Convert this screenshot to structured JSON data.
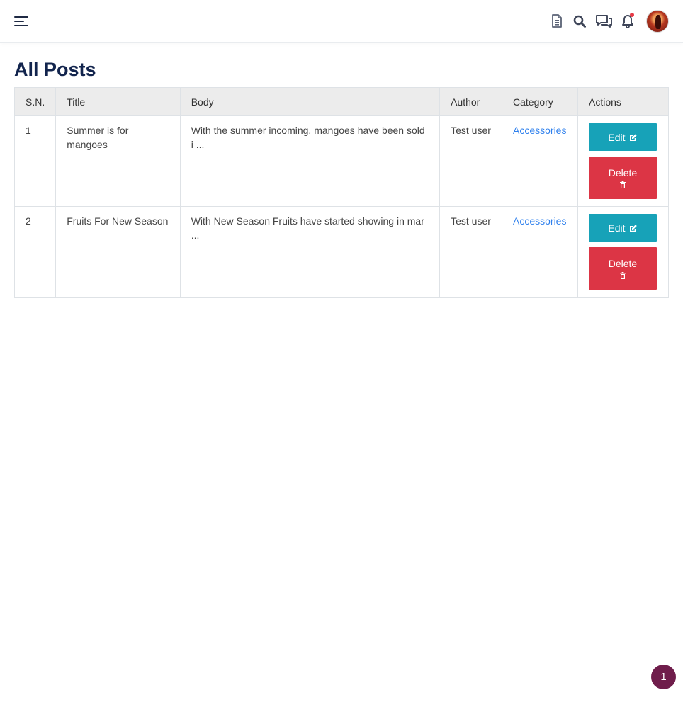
{
  "header": {
    "icons": [
      "menu-icon",
      "document-icon",
      "search-icon",
      "chat-icon",
      "bell-icon",
      "avatar"
    ]
  },
  "page": {
    "title": "All Posts"
  },
  "table": {
    "columns": [
      "S.N.",
      "Title",
      "Body",
      "Author",
      "Category",
      "Actions"
    ],
    "rows": [
      {
        "sn": "1",
        "title": "Summer is for mangoes",
        "body": "With the summer incoming, mangoes have been sold i ...",
        "author": "Test user",
        "category": "Accessories"
      },
      {
        "sn": "2",
        "title": "Fruits For New Season",
        "body": "With New Season Fruits have started showing in mar ...",
        "author": "Test user",
        "category": "Accessories"
      }
    ],
    "edit_label": "Edit",
    "delete_label": "Delete"
  },
  "fab": {
    "label": "1"
  },
  "colors": {
    "title": "#12244d",
    "edit": "#17a2b8",
    "delete": "#dc3545",
    "link": "#2f80ed",
    "fab": "#6f1d4b",
    "notification_dot": "#e63946"
  }
}
